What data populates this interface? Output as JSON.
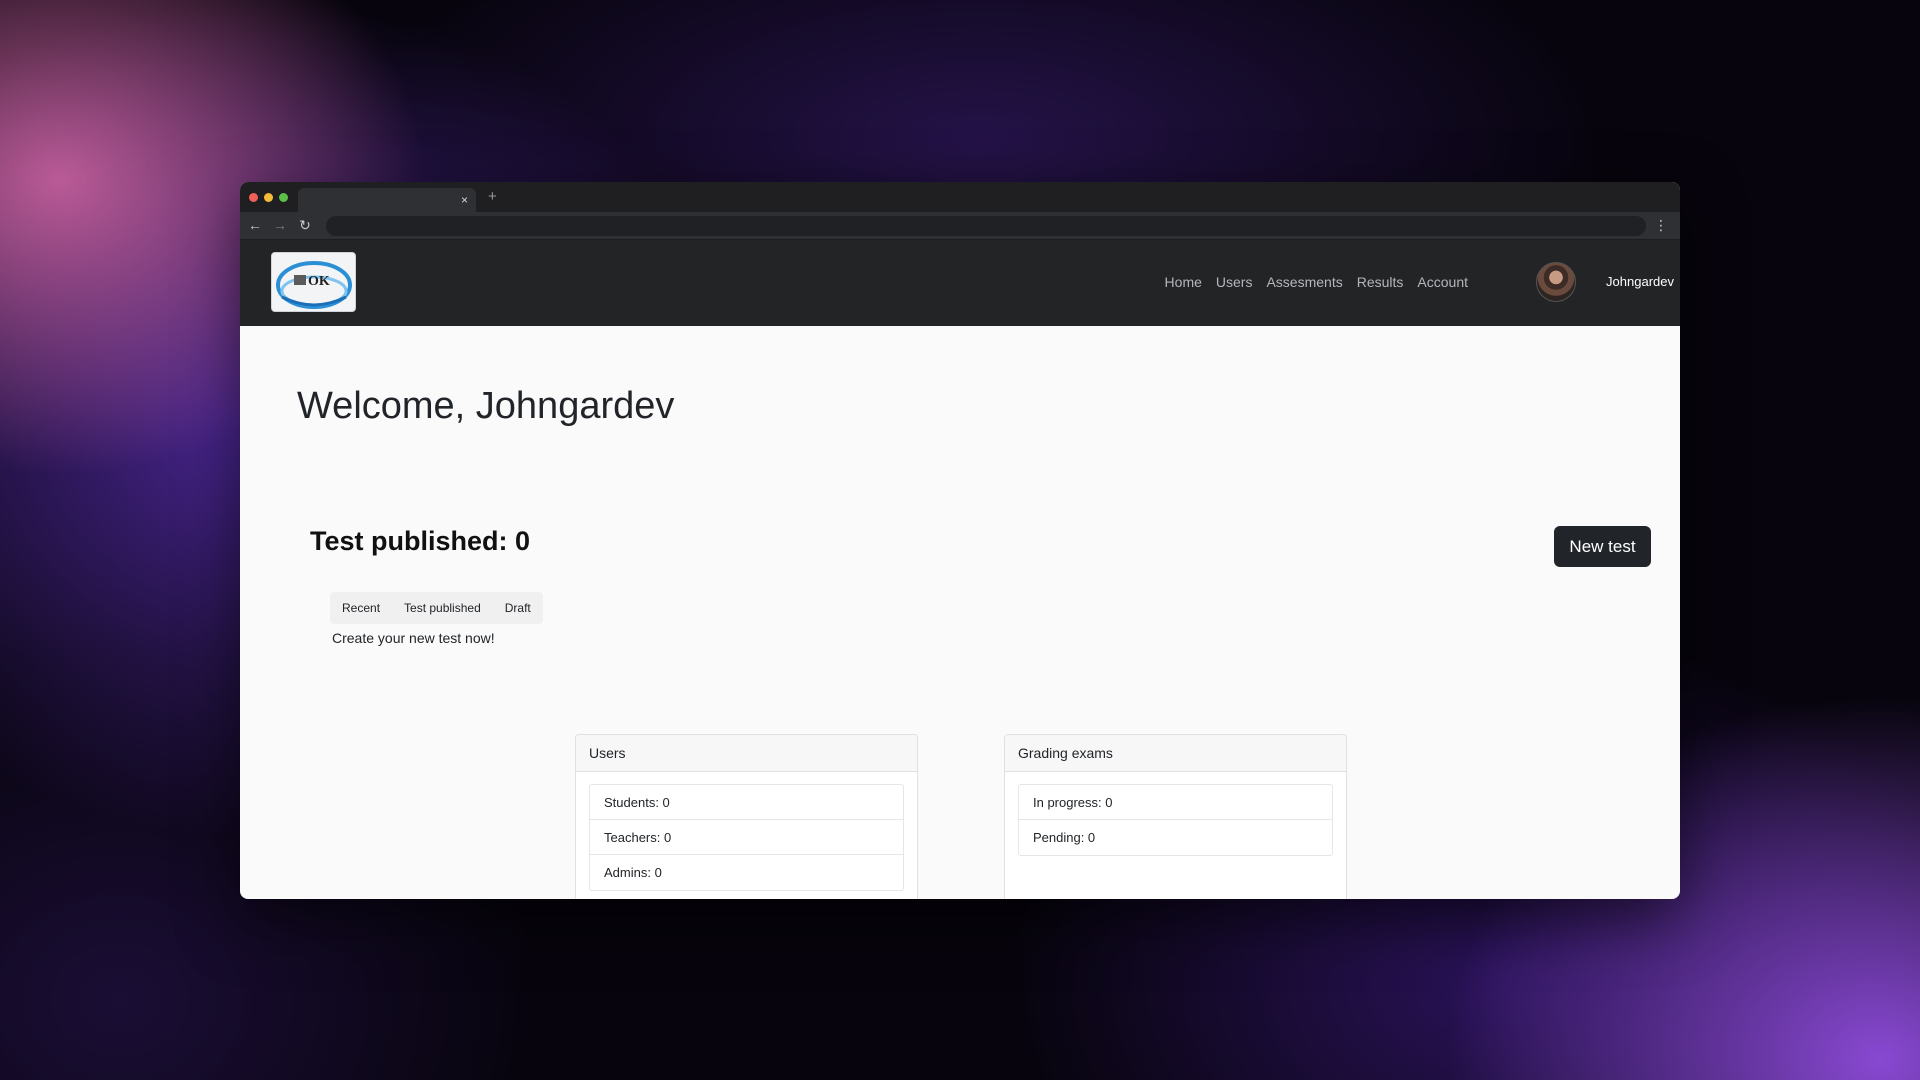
{
  "browser": {
    "tab_close_glyph": "×",
    "tab_new_glyph": "+",
    "back_glyph": "←",
    "forward_glyph": "→",
    "reload_glyph": "↻",
    "menu_glyph": "⋮"
  },
  "header": {
    "logo_text": "OK",
    "nav": [
      "Home",
      "Users",
      "Assesments",
      "Results",
      "Account"
    ],
    "username": "Johngardev"
  },
  "main": {
    "welcome": "Welcome, Johngardev",
    "published_heading": "Test published: 0",
    "new_test_label": "New test",
    "tabs": [
      "Recent",
      "Test published",
      "Draft"
    ],
    "empty_message": "Create your new test now!"
  },
  "cards": {
    "users": {
      "title": "Users",
      "items": [
        "Students: 0",
        "Teachers: 0",
        "Admins: 0"
      ]
    },
    "grading": {
      "title": "Grading exams",
      "items": [
        "In progress: 0",
        "Pending: 0"
      ]
    }
  },
  "colors": {
    "header_bg": "#222426",
    "button_bg": "#212529",
    "page_bg": "#fafafa"
  }
}
